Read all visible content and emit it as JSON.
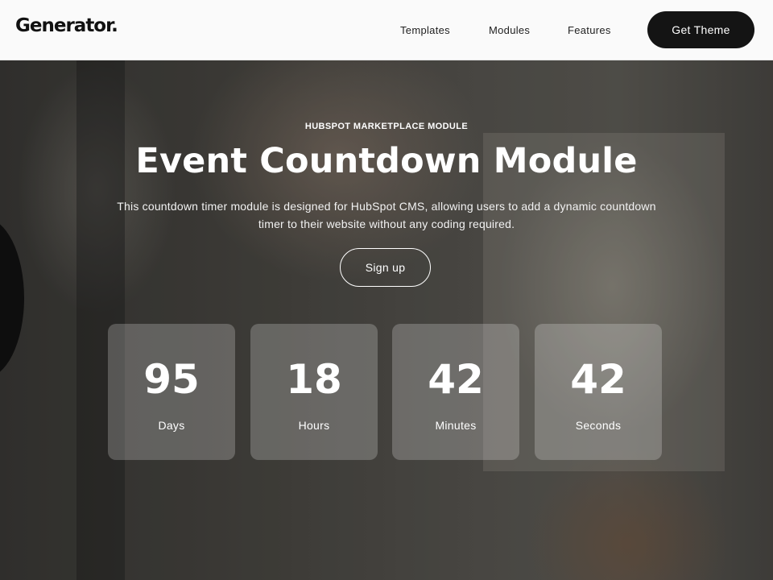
{
  "header": {
    "logo": "Generator.",
    "nav": [
      "Templates",
      "Modules",
      "Features"
    ],
    "cta_label": "Get Theme"
  },
  "hero": {
    "eyebrow": "HUBSPOT MARKETPLACE MODULE",
    "title": "Event Countdown Module",
    "description": "This countdown timer module is designed for HubSpot CMS, allowing users to add a dynamic countdown timer to their website without any coding required.",
    "signup_label": "Sign up"
  },
  "countdown": [
    {
      "value": "95",
      "label": "Days"
    },
    {
      "value": "18",
      "label": "Hours"
    },
    {
      "value": "42",
      "label": "Minutes"
    },
    {
      "value": "42",
      "label": "Seconds"
    }
  ],
  "colors": {
    "header_bg": "#fafafa",
    "cta_bg": "#141414",
    "text_light": "#ffffff"
  }
}
